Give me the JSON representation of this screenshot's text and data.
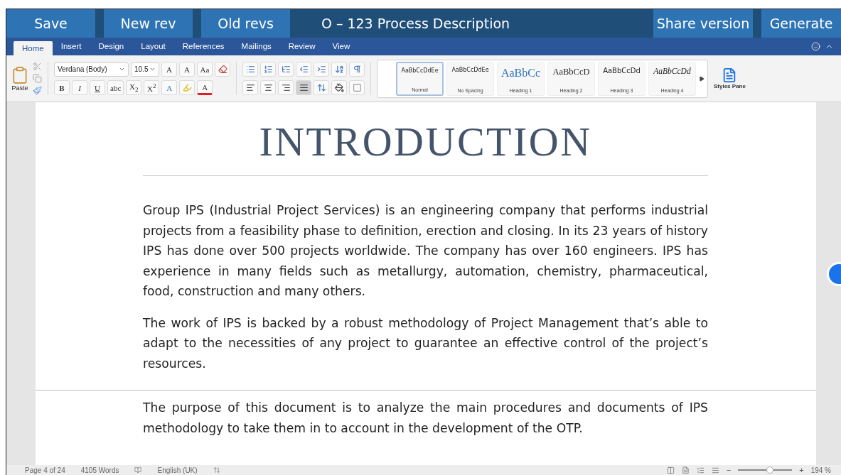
{
  "top_bar": {
    "buttons_left": [
      "Save",
      "New rev",
      "Old revs"
    ],
    "title": "O – 123 Process Description",
    "buttons_right": [
      "Share version",
      "Generate"
    ]
  },
  "ribbon_tabs": [
    {
      "label": "Home",
      "selected": true
    },
    {
      "label": "Insert",
      "selected": false
    },
    {
      "label": "Design",
      "selected": false
    },
    {
      "label": "Layout",
      "selected": false
    },
    {
      "label": "References",
      "selected": false
    },
    {
      "label": "Mailings",
      "selected": false
    },
    {
      "label": "Review",
      "selected": false
    },
    {
      "label": "View",
      "selected": false
    }
  ],
  "ribbon": {
    "paste_label": "Paste",
    "font_family": "Verdana (Body)",
    "font_size": "10.5",
    "grow_font": "A",
    "shrink_font": "A",
    "change_case": "Aa",
    "format_buttons": [
      {
        "label": "B"
      },
      {
        "label": "I"
      },
      {
        "label": "U"
      },
      {
        "label": "abc"
      },
      {
        "label": "X$_{2}$"
      },
      {
        "label": "X$^{2}$"
      }
    ],
    "text_effects": "A",
    "font_color": "A",
    "alignments": [
      {
        "kind": "left",
        "selected": false
      },
      {
        "kind": "center",
        "selected": false
      },
      {
        "kind": "right",
        "selected": false
      },
      {
        "kind": "justify",
        "selected": true
      }
    ],
    "styles": [
      {
        "kind": "normal",
        "preview": "AaBbCcDdEe",
        "name": "Normal",
        "selected": true
      },
      {
        "kind": "plain",
        "preview": "AaBbCcDdEe",
        "name": "No Spacing",
        "selected": false
      },
      {
        "kind": "heading1",
        "preview": "AaBbCc",
        "name": "Heading 1",
        "selected": false
      },
      {
        "kind": "heading2",
        "preview": "AaBbCcD",
        "name": "Heading 2",
        "selected": false
      },
      {
        "kind": "heading3",
        "preview": "AaBbCcDd",
        "name": "Heading 3",
        "selected": false
      },
      {
        "kind": "heading4",
        "preview": "AaBbCcDd",
        "name": "Heading 4",
        "selected": false
      }
    ],
    "styles_pane_label": "Styles Pane"
  },
  "document": {
    "heading": "INTRODUCTION",
    "pages": [
      {
        "paragraphs": [
          "Group IPS (Industrial Project Services) is an engineering company that performs industrial projects from a feasibility phase to definition, erection and closing. In its 23 years of history IPS has done over 500 projects worldwide. The company has over 160 engineers. IPS has experience in many fields such as metallurgy, automation, chemistry, pharmaceutical, food, construction and many others.",
          "The work of IPS is backed by a robust methodology of Project Management that’s able to adapt to the necessities of any project to guarantee an effective control of the project’s resources."
        ]
      },
      {
        "paragraphs": [
          "The purpose of this document is to analyze the main procedures and documents of IPS methodology to take them in to account in the development of the OTP."
        ]
      }
    ]
  },
  "status_bar": {
    "page": "Page 4 of 24",
    "words": "4105 Words",
    "language": "English (UK)",
    "zoom_out": "−",
    "zoom_in": "+",
    "zoom": {
      "level": 0.59
    },
    "zoom_reading": "194 %"
  }
}
